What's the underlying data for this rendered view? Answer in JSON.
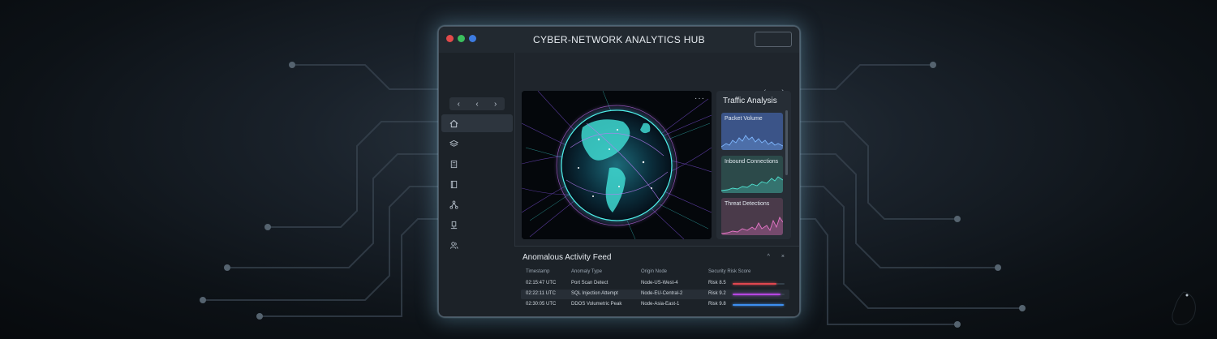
{
  "window": {
    "title": "CYBER-NETWORK ANALYTICS HUB"
  },
  "sidebar": {
    "nav_arrows": [
      "‹",
      "‹",
      "›"
    ],
    "items": [
      {
        "icon": "home-icon"
      },
      {
        "icon": "layers-icon"
      },
      {
        "icon": "calculator-icon"
      },
      {
        "icon": "book-icon"
      },
      {
        "icon": "network-icon"
      },
      {
        "icon": "device-icon"
      },
      {
        "icon": "users-icon"
      }
    ]
  },
  "content": {
    "nav_arrows": "‹ ›",
    "globe_menu": "···"
  },
  "traffic_analysis": {
    "title": "Traffic Analysis",
    "cards": [
      {
        "label": "Packet Volume",
        "color": "#7fb8ff",
        "bg": "#3b5488"
      },
      {
        "label": "Inbound Connections",
        "color": "#4fe0cf",
        "bg": "#2c4a4a"
      },
      {
        "label": "Threat Detections",
        "color": "#e676c8",
        "bg": "#4a3a4a"
      }
    ]
  },
  "feed": {
    "title": "Anomalous Activity Feed",
    "controls": "^ ×",
    "headers": [
      "Timestamp",
      "Anomaly Type",
      "Origin Node",
      "Security Risk Score"
    ],
    "rows": [
      {
        "timestamp": "02:15:47 UTC",
        "type": "Port Scan Detect",
        "node": "Node-US-West-4",
        "risk": "Risk 8.5",
        "score": 0.85,
        "color": "#e0474f"
      },
      {
        "timestamp": "02:22:11 UTC",
        "type": "SQL Injection Attempt",
        "node": "Node-EU-Central-2",
        "risk": "Risk 9.2",
        "score": 0.92,
        "color": "#b546e0"
      },
      {
        "timestamp": "02:30:05 UTC",
        "type": "DDOS Volumetric Peak",
        "node": "Node-Asia-East-1",
        "risk": "Risk 9.8",
        "score": 0.98,
        "color": "#3d8ff0"
      }
    ]
  }
}
